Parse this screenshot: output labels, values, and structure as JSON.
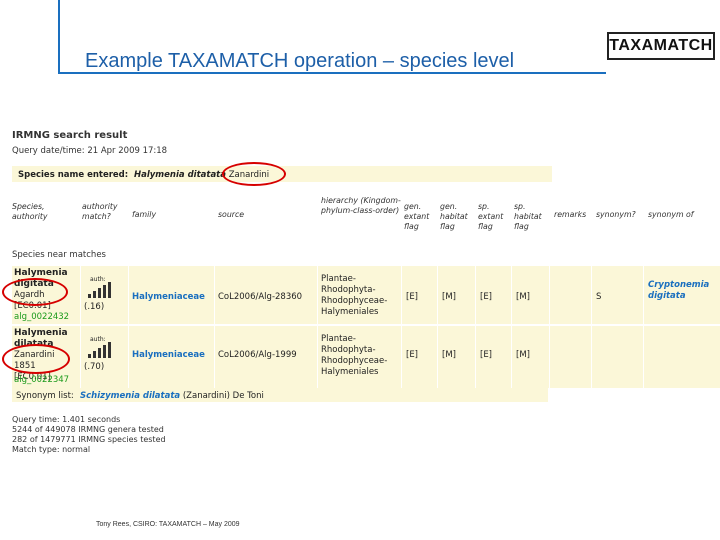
{
  "slide": {
    "title": "Example TAXAMATCH operation – species level",
    "logo": "TAXAMATCH",
    "footer": "Tony Rees, CSIRO: TAXAMATCH – May 2009"
  },
  "search": {
    "title": "IRMNG search result",
    "query_date": "Query date/time: 21 Apr 2009 17:18",
    "entered_label": "Species name entered:",
    "entered_genus_species": "Halymenia ditatata",
    "entered_author": "Zanardini"
  },
  "table": {
    "headers": [
      "Species, authority",
      "authority match?",
      "family",
      "source",
      "hierarchy (Kingdom-phylum-class-order)",
      "gen. extant flag",
      "gen. habitat flag",
      "sp. extant flag",
      "sp. habitat flag",
      "remarks",
      "synonym?",
      "synonym of"
    ],
    "near_matches_label": "Species near matches",
    "rows": [
      {
        "name_line1": "Halymenia",
        "name_line2": "digitata",
        "author_line1": "Agardh",
        "author_line2": "[EC0.01]",
        "id": "alg_0022432",
        "auth_label": "auth:",
        "match": "(.16)",
        "family": "Halymeniaceae",
        "source": "CoL2006/Alg-28360",
        "hierarchy": [
          "Plantae-",
          "Rhodophyta-",
          "Rhodophyceae-",
          "Halymeniales"
        ],
        "gen_extant": "[E]",
        "gen_habitat": "[M]",
        "sp_extant": "[E]",
        "sp_habitat": "[M]",
        "synonym": "S",
        "synonym_of_1": "Cryptonemia",
        "synonym_of_2": "digitata"
      },
      {
        "name_line1": "Halymenia",
        "name_line2": "dilatata",
        "author_line1": "Zanardini",
        "author_line2": "1851",
        "author_line3": "[EC0.01]",
        "id": "alg_0022347",
        "auth_label": "auth:",
        "match": "(.70)",
        "family": "Halymeniaceae",
        "source": "CoL2006/Alg-1999",
        "hierarchy": [
          "Plantae-",
          "Rhodophyta-",
          "Rhodophyceae-",
          "Halymeniales"
        ],
        "gen_extant": "[E]",
        "gen_habitat": "[M]",
        "sp_extant": "[E]",
        "sp_habitat": "[M]"
      }
    ]
  },
  "synonym_list": {
    "label": "Synonym list:",
    "name_italic": "Schizymenia dilatata",
    "name_rest": "(Zanardini) De Toni"
  },
  "stats": [
    "Query time: 1.401 seconds",
    "5244 of 449078 IRMNG genera tested",
    "282 of 1479771 IRMNG species tested",
    "Match type: normal"
  ],
  "colors": {
    "accent": "#1a6fbf",
    "highlight": "#d60000",
    "row_bg": "#fbf7d8",
    "id_green": "#1a9a1a"
  }
}
